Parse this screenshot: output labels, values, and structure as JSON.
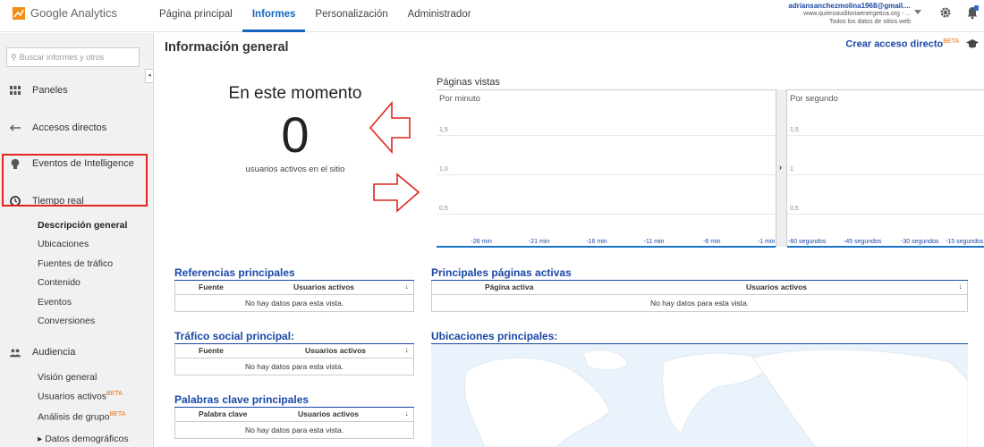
{
  "app": {
    "logo_text": "Google Analytics",
    "nav": [
      "Página principal",
      "Informes",
      "Personalización",
      "Administrador"
    ],
    "active_nav": "Informes",
    "account_name": "adriansanchezmolina1968@gmail....",
    "account_site": "www.quieroauditoriaenergetica.org - ...",
    "account_view": "Todos los datos de sitios web"
  },
  "sidebar": {
    "search_placeholder": "Buscar informes y otros",
    "sections": [
      {
        "label": "Paneles",
        "icon": "grid-icon"
      },
      {
        "label": "Accesos directos",
        "icon": "shortcut-arrow-icon"
      },
      {
        "label": "Eventos de Intelligence",
        "icon": "lightbulb-icon"
      },
      {
        "label": "Tiempo real",
        "icon": "clock-icon"
      },
      {
        "label": "Audiencia",
        "icon": "people-icon"
      }
    ],
    "realtime_items": [
      "Descripción general",
      "Ubicaciones",
      "Fuentes de tráfico",
      "Contenido",
      "Eventos",
      "Conversiones"
    ],
    "audience_items": [
      "Visión general",
      "Usuarios activos",
      "Análisis de grupo",
      "▸ Datos demográficos"
    ],
    "beta_label": "BETA",
    "collapse": "◂"
  },
  "main": {
    "title": "Información general",
    "shortcut_label": "Crear acceso directo",
    "shortcut_badge": "BETA",
    "now_label": "En este momento",
    "now_value": "0",
    "now_sub": "usuarios activos en el sitio"
  },
  "chart_data": {
    "type": "line",
    "title": "Páginas vistas",
    "panels": [
      {
        "label": "Por minuto",
        "y_ticks": [
          "1,5",
          "1,0",
          "0,5"
        ],
        "x_ticks": [
          "-26 min",
          "-21 min",
          "-16 min",
          "-11 min",
          "-6 min",
          "-1 min"
        ],
        "values": []
      },
      {
        "label": "Por segundo",
        "y_ticks": [
          "1,5",
          "1",
          "0,5"
        ],
        "x_ticks": [
          "-60 segundos",
          "-45 segundos",
          "-30 segundos",
          "-15 segundos"
        ],
        "values": []
      }
    ],
    "ylim": [
      0,
      1.5
    ],
    "expand": "›"
  },
  "tables": {
    "referencias": {
      "title": "Referencias principales",
      "cols": [
        "Fuente",
        "Usuarios activos"
      ],
      "empty": "No hay datos para esta vista."
    },
    "social": {
      "title": "Tráfico social principal:",
      "cols": [
        "Fuente",
        "Usuarios activos"
      ],
      "empty": "No hay datos para esta vista."
    },
    "palabras": {
      "title": "Palabras clave principales",
      "cols": [
        "Palabra clave",
        "Usuarios activos"
      ],
      "empty": "No hay datos para esta vista."
    },
    "paginas": {
      "title": "Principales páginas activas",
      "cols": [
        "Página activa",
        "Usuarios activos"
      ],
      "empty": "No hay datos para esta vista."
    },
    "ubicaciones": {
      "title": "Ubicaciones principales:"
    }
  },
  "sort_glyph": "↓",
  "colors": {
    "accent": "#1565c0",
    "highlight": "#e1261c",
    "beta": "#e8710a"
  }
}
